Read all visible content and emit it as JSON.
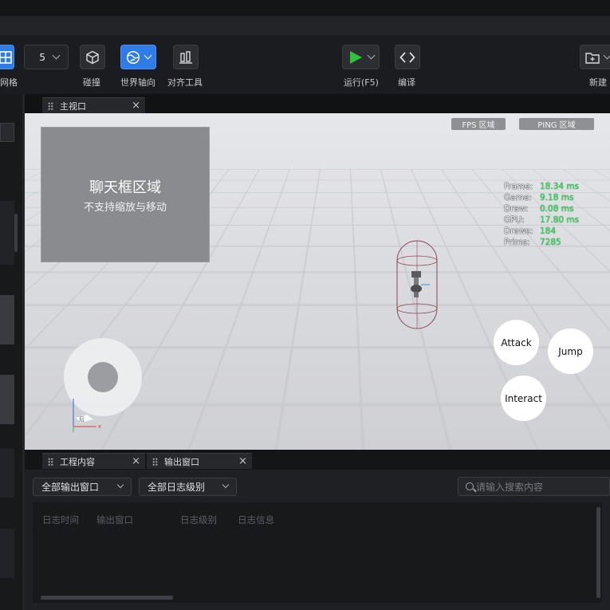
{
  "toolbar": {
    "grid_label": "网格",
    "grid_size_value": "5",
    "collision_label": "碰撞",
    "world_axis_label": "世界轴向",
    "align_tool_label": "对齐工具",
    "run_label": "运行(F5)",
    "compile_label": "编译",
    "new_label": "新建"
  },
  "viewport": {
    "tab_label": "主视口",
    "chat_title": "聊天框区域",
    "chat_subtitle": "不支持缩放与移动",
    "fps_label": "FPS 区域",
    "ping_label": "PING 区域",
    "stats": [
      {
        "key": "Frame:",
        "value": "18.34 ms"
      },
      {
        "key": "Game:",
        "value": "9.18 ms"
      },
      {
        "key": "Draw:",
        "value": "0.08 ms"
      },
      {
        "key": "GPU:",
        "value": "17.80 ms"
      },
      {
        "key": "Draws:",
        "value": "184"
      },
      {
        "key": "Prims:",
        "value": "7285"
      }
    ],
    "attack_label": "Attack",
    "jump_label": "Jump",
    "interact_label": "Interact",
    "gizmo_back_label": "后",
    "gizmo_x_label": "x"
  },
  "bottom": {
    "tab_project": "工程内容",
    "tab_output": "输出窗口",
    "filter_window": "全部输出窗口",
    "filter_level": "全部日志级别",
    "search_placeholder": "请输入搜索内容",
    "columns": [
      "日志时间",
      "输出窗口",
      "日志级别",
      "日志信息"
    ]
  },
  "colors": {
    "accent": "#2f7be8",
    "play_green": "#2fc23d",
    "stats_green": "#2fe25a"
  }
}
